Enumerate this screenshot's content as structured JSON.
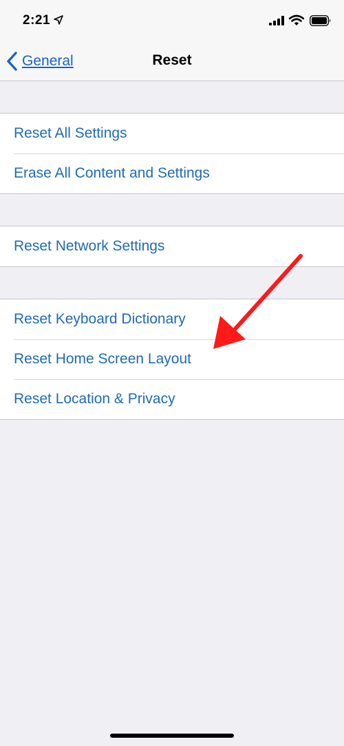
{
  "status_bar": {
    "time": "2:21",
    "icons": [
      "location-arrow-icon",
      "cellular-signal-icon",
      "wifi-icon",
      "battery-icon"
    ]
  },
  "nav": {
    "back_label": "General",
    "title": "Reset"
  },
  "groups": [
    {
      "items": [
        {
          "label": "Reset All Settings"
        },
        {
          "label": "Erase All Content and Settings"
        }
      ]
    },
    {
      "items": [
        {
          "label": "Reset Network Settings"
        }
      ]
    },
    {
      "items": [
        {
          "label": "Reset Keyboard Dictionary"
        },
        {
          "label": "Reset Home Screen Layout"
        },
        {
          "label": "Reset Location & Privacy"
        }
      ]
    }
  ],
  "colors": {
    "link_blue": "#1f6bb8",
    "background": "#efeff4",
    "annotation_arrow": "#ff1a1a"
  }
}
